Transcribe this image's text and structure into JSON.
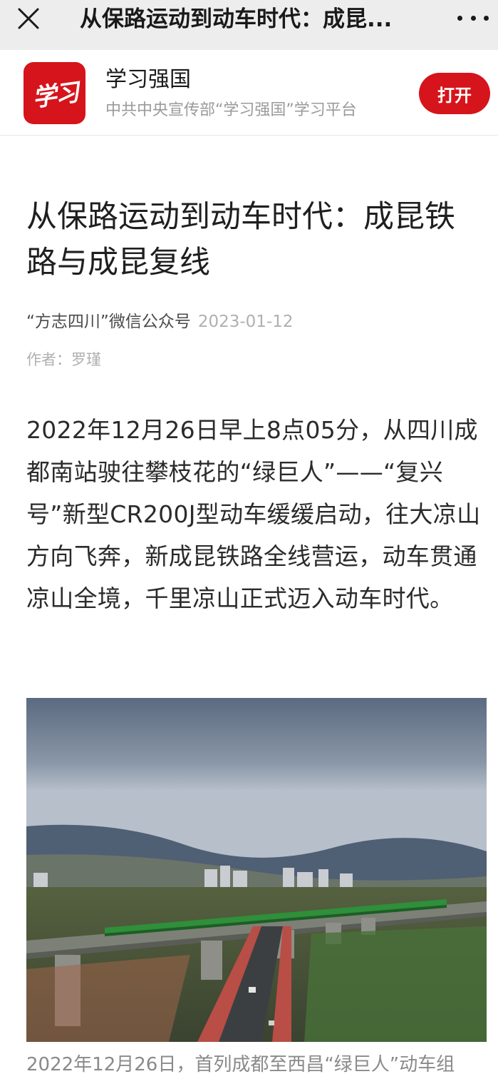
{
  "nav": {
    "title": "从保路运动到动车时代：成昆...",
    "close_icon": "close-icon",
    "more_icon": "more-icon"
  },
  "app_banner": {
    "logo_text": "学习",
    "name": "学习强国",
    "description": "中共中央宣传部“学习强国”学习平台",
    "open_label": "打开",
    "brand_color": "#d6141b"
  },
  "article": {
    "title": "从保路运动到动车时代：成昆铁路与成昆复线",
    "source": "“方志四川”微信公众号",
    "date": "2023-01-12",
    "author": "作者：罗瑾",
    "paragraph": "2022年12月26日早上8点05分，从四川成都南站驶往攀枝花的“绿巨人”——“复兴号”新型CR200J型动车缓缓启动，往大凉山方向飞奔，新成昆铁路全线营运，动车贯通凉山全境，千里凉山正式迈入动车时代。",
    "caption": "2022年12月26日，首列成都至西昌“绿巨人”动车组"
  }
}
